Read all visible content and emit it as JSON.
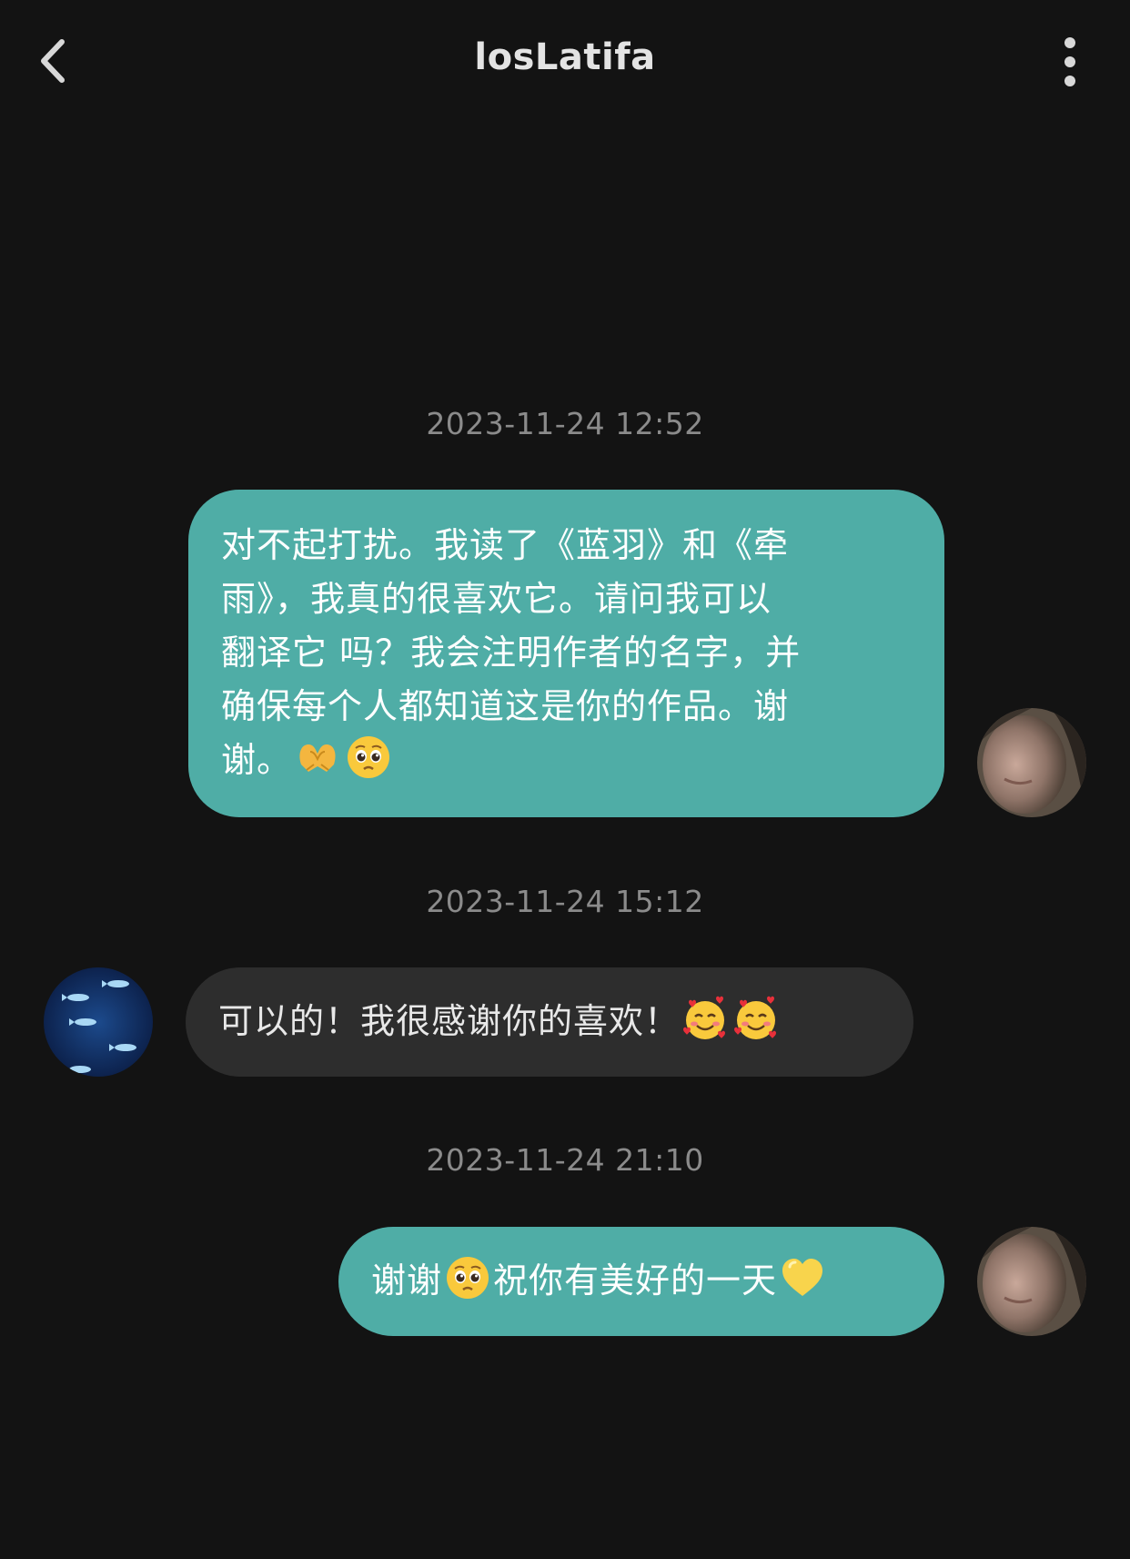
{
  "header": {
    "title": "losLatifa",
    "back_icon": "chevron-left-icon",
    "more_icon": "more-vertical-icon"
  },
  "colors": {
    "background": "#131313",
    "sent_bubble": "#4fada6",
    "received_bubble": "#2d2d2d",
    "timestamp": "#8b8b8b"
  },
  "messages": [
    {
      "timestamp": "2023-11-24 12:52",
      "direction": "sent",
      "text_lines": [
        "对不起打扰。我读了《蓝羽》和《牵",
        "雨》，我真的很喜欢它。请问我可以",
        "翻译它 吗？我会注明作者的名字，并",
        "确保每个人都知道这是你的作品。谢",
        "谢。"
      ],
      "emojis": [
        "heart-hands-emoji",
        "pleading-face-emoji"
      ]
    },
    {
      "timestamp": "2023-11-24 15:12",
      "direction": "received",
      "text": "可以的！我很感谢你的喜欢！",
      "emojis": [
        "smiling-face-with-hearts-emoji",
        "smiling-face-with-hearts-emoji"
      ]
    },
    {
      "timestamp": "2023-11-24 21:10",
      "direction": "sent",
      "text_before": "谢谢",
      "emoji_mid": "pleading-face-emoji",
      "text_after": "祝你有美好的一天",
      "emoji_end": "yellow-heart-emoji"
    }
  ]
}
